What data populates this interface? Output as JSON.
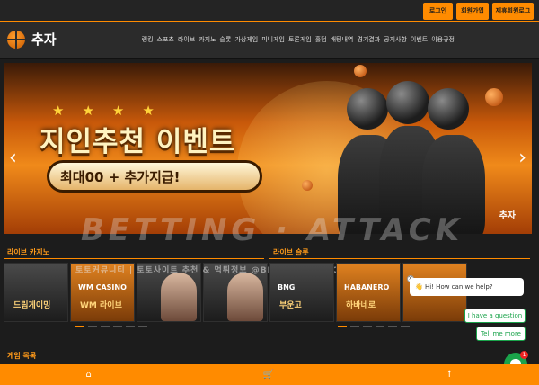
{
  "topbar": {
    "login": "로그인",
    "signup": "회원가입",
    "partner_login": "제휴회원로그"
  },
  "header": {
    "logo_text": "추자",
    "nav": [
      "랭킹",
      "스포츠",
      "라이브",
      "카지노",
      "슬롯",
      "가상게임",
      "미니게임",
      "토론게임",
      "홀덤",
      "배팅내역",
      "경기결과",
      "공지사항",
      "이벤트",
      "이용규정"
    ]
  },
  "banner": {
    "title": "지인추천 이벤트",
    "pill_text": "최대00 + 추가지급!",
    "brand": "추자",
    "prev_arrow": "‹",
    "next_arrow": "›"
  },
  "watermark": {
    "main": "BETTING · ATTACK",
    "ticker": "토토커뮤니티 | 토토사이트 추천 & 먹튀정보 @BETTINGATTACK24"
  },
  "sections": {
    "live_casino": {
      "title": "라이브 카지노",
      "tiles": [
        {
          "brand": "",
          "label": "드림게이밍"
        },
        {
          "brand": "WM CASINO",
          "label": "WM 라이브"
        },
        {
          "brand": "",
          "label": ""
        },
        {
          "brand": "",
          "label": ""
        }
      ]
    },
    "live_slot": {
      "title": "라이브 슬롯",
      "tiles": [
        {
          "brand": "BNG",
          "label": "부운고"
        },
        {
          "brand": "HABANERO",
          "label": "하바네로"
        },
        {
          "brand": "",
          "label": ""
        }
      ]
    },
    "game_list": {
      "title": "게임 목록"
    }
  },
  "chat": {
    "greeting": "👋 Hi! How can we help?",
    "close": "×",
    "question_chip": "I have a question",
    "more_chip": "Tell me more",
    "badge": "1"
  },
  "bottom": {
    "home_icon": "⌂",
    "cart_icon": "🛒",
    "up_icon": "↑"
  },
  "colors": {
    "accent": "#ff8b00",
    "header_bg": "#2b2b2b",
    "chat_green": "#1aa34a"
  }
}
